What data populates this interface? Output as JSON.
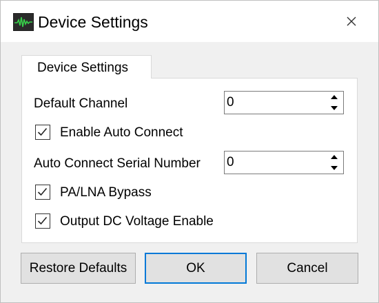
{
  "window": {
    "title": "Device Settings",
    "app_icon": "waveform-app-icon",
    "close_icon": "close-icon"
  },
  "tab": {
    "label": "Device Settings"
  },
  "fields": {
    "default_channel": {
      "label": "Default Channel",
      "value": "0"
    },
    "enable_auto_connect": {
      "label": "Enable Auto Connect",
      "checked": true
    },
    "auto_connect_serial": {
      "label": "Auto Connect Serial Number",
      "value": "0"
    },
    "pa_lna_bypass": {
      "label": "PA/LNA Bypass",
      "checked": true
    },
    "output_dc_voltage": {
      "label": "Output DC Voltage Enable",
      "checked": true
    }
  },
  "buttons": {
    "restore_defaults": "Restore Defaults",
    "ok": "OK",
    "cancel": "Cancel"
  },
  "colors": {
    "accent": "#0078d7",
    "dialog_bg": "#f0f0f0",
    "button_bg": "#e1e1e1"
  }
}
